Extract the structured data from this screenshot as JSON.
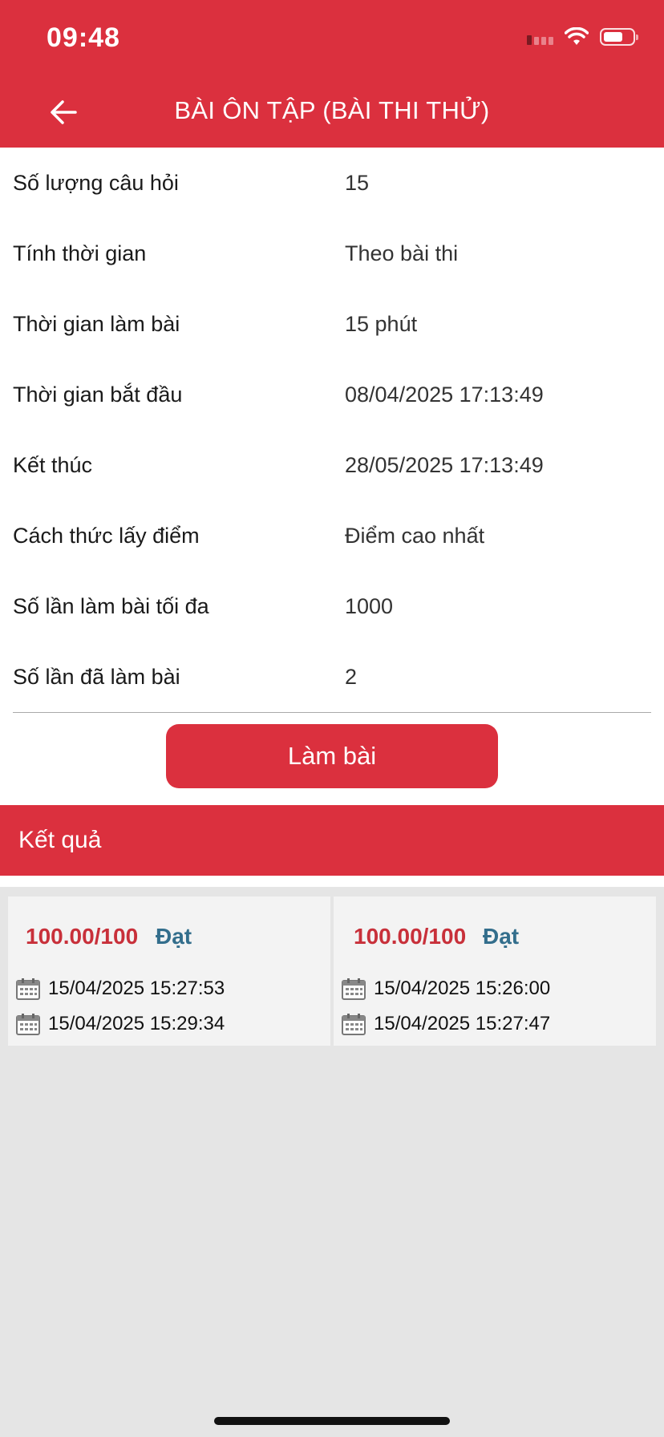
{
  "status_bar": {
    "time": "09:48"
  },
  "header": {
    "title": "BÀI ÔN TẬP (BÀI THI THỬ)"
  },
  "info_rows": [
    {
      "label": "Số lượng câu hỏi",
      "value": "15"
    },
    {
      "label": "Tính thời gian",
      "value": "Theo bài thi"
    },
    {
      "label": "Thời gian làm bài",
      "value": "15 phút"
    },
    {
      "label": "Thời gian bắt đầu",
      "value": "08/04/2025 17:13:49"
    },
    {
      "label": "Kết thúc",
      "value": "28/05/2025 17:13:49"
    },
    {
      "label": "Cách thức lấy điểm",
      "value": "Điểm cao nhất"
    },
    {
      "label": "Số lần làm bài tối đa",
      "value": "1000"
    },
    {
      "label": "Số lần đã làm bài",
      "value": "2"
    }
  ],
  "start_button": "Làm bài",
  "results": {
    "title": "Kết quả",
    "items": [
      {
        "score": "100.00/100",
        "status": "Đạt",
        "start": "15/04/2025 15:27:53",
        "end": "15/04/2025 15:29:34"
      },
      {
        "score": "100.00/100",
        "status": "Đạt",
        "start": "15/04/2025 15:26:00",
        "end": "15/04/2025 15:27:47"
      }
    ]
  },
  "icons": [
    "back-arrow-icon",
    "wifi-icon",
    "battery-icon",
    "signal-icon",
    "calendar-icon"
  ],
  "colors": {
    "primary": "#db303e",
    "score": "#c8303a",
    "status_pass": "#336e8c"
  }
}
